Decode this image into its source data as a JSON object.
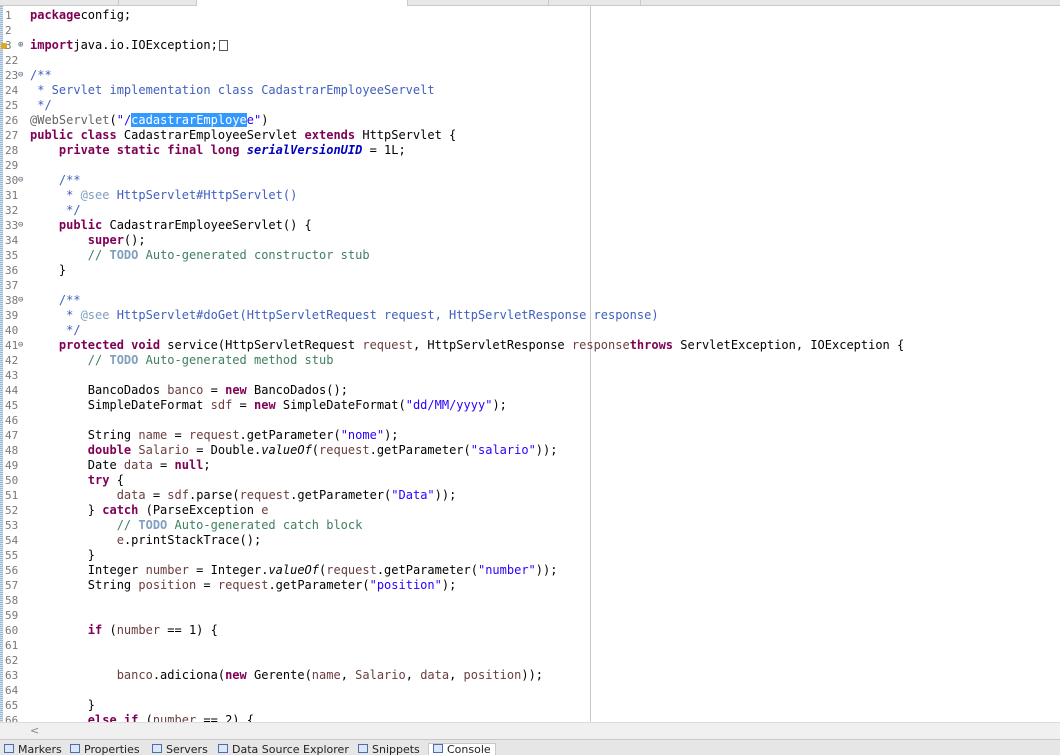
{
  "editor": {
    "lines": [
      {
        "n": "1",
        "fold": "",
        "warn": false,
        "tokens": [
          [
            "kw",
            "package"
          ],
          [
            "",
            "config;"
          ]
        ]
      },
      {
        "n": "2",
        "fold": "",
        "warn": false,
        "tokens": []
      },
      {
        "n": "3",
        "fold": "⊕",
        "warn": true,
        "tokens": [
          [
            "kw",
            "import"
          ],
          [
            "",
            "java.io.IOException;"
          ],
          [
            "box",
            ""
          ]
        ]
      },
      {
        "n": "22",
        "fold": "",
        "warn": false,
        "tokens": []
      },
      {
        "n": "23",
        "fold": "⊖",
        "warn": false,
        "tokens": [
          [
            "jd",
            "/**"
          ]
        ]
      },
      {
        "n": "24",
        "fold": "",
        "warn": false,
        "tokens": [
          [
            "jd",
            " * Servlet implementation class CadastrarEmployeeServelt"
          ]
        ]
      },
      {
        "n": "25",
        "fold": "",
        "warn": false,
        "tokens": [
          [
            "jd",
            " */"
          ]
        ]
      },
      {
        "n": "26",
        "fold": "",
        "warn": false,
        "tokens": [
          [
            "ann",
            "@WebServlet"
          ],
          [
            "",
            "("
          ],
          [
            "str",
            "\"/"
          ],
          [
            "sel",
            "cadastrarEmploye"
          ],
          [
            "str",
            "e\""
          ],
          [
            "",
            ")"
          ]
        ]
      },
      {
        "n": "27",
        "fold": "",
        "warn": false,
        "tokens": [
          [
            "kw",
            "public class"
          ],
          [
            "",
            " CadastrarEmployeeServlet "
          ],
          [
            "kw",
            "extends"
          ],
          [
            "",
            " HttpServlet {"
          ]
        ]
      },
      {
        "n": "28",
        "fold": "",
        "warn": false,
        "tokens": [
          [
            "",
            "    "
          ],
          [
            "kw",
            "private static final long"
          ],
          [
            "",
            " "
          ],
          [
            "sfld",
            "serialVersionUID"
          ],
          [
            "",
            " = 1L;"
          ]
        ]
      },
      {
        "n": "29",
        "fold": "",
        "warn": false,
        "tokens": []
      },
      {
        "n": "30",
        "fold": "⊖",
        "warn": false,
        "tokens": [
          [
            "jd",
            "    /**"
          ]
        ]
      },
      {
        "n": "31",
        "fold": "",
        "warn": false,
        "tokens": [
          [
            "jd",
            "     * "
          ],
          [
            "tag",
            "@see"
          ],
          [
            "jd",
            " HttpServlet#HttpServlet()"
          ]
        ]
      },
      {
        "n": "32",
        "fold": "",
        "warn": false,
        "tokens": [
          [
            "jd",
            "     */"
          ]
        ]
      },
      {
        "n": "33",
        "fold": "⊖",
        "warn": false,
        "tokens": [
          [
            "",
            "    "
          ],
          [
            "kw",
            "public"
          ],
          [
            "",
            " CadastrarEmployeeServlet() {"
          ]
        ]
      },
      {
        "n": "34",
        "fold": "",
        "warn": false,
        "tokens": [
          [
            "",
            "        "
          ],
          [
            "kw",
            "super"
          ],
          [
            "",
            "();"
          ]
        ]
      },
      {
        "n": "35",
        "fold": "",
        "warn": false,
        "tokens": [
          [
            "cm",
            "        // "
          ],
          [
            "todo",
            "TODO"
          ],
          [
            "cm",
            " Auto-generated constructor stub"
          ]
        ]
      },
      {
        "n": "36",
        "fold": "",
        "warn": false,
        "tokens": [
          [
            "",
            "    }"
          ]
        ]
      },
      {
        "n": "37",
        "fold": "",
        "warn": false,
        "tokens": []
      },
      {
        "n": "38",
        "fold": "⊖",
        "warn": false,
        "tokens": [
          [
            "jd",
            "    /**"
          ]
        ]
      },
      {
        "n": "39",
        "fold": "",
        "warn": false,
        "tokens": [
          [
            "jd",
            "     * "
          ],
          [
            "tag",
            "@see"
          ],
          [
            "jd",
            " HttpServlet#doGet(HttpServletRequest request, HttpServletResponse response)"
          ]
        ]
      },
      {
        "n": "40",
        "fold": "",
        "warn": false,
        "tokens": [
          [
            "jd",
            "     */"
          ]
        ]
      },
      {
        "n": "41",
        "fold": "⊖",
        "warn": false,
        "tokens": [
          [
            "",
            "    "
          ],
          [
            "kw",
            "protected void"
          ],
          [
            "",
            " service(HttpServletRequest "
          ],
          [
            "var",
            "request"
          ],
          [
            "",
            ", HttpServletResponse "
          ],
          [
            "var",
            "response"
          ],
          [
            ") "
          ],
          [
            "kw",
            "throws"
          ],
          [
            "",
            " ServletException, IOException {"
          ]
        ]
      },
      {
        "n": "42",
        "fold": "",
        "warn": false,
        "tokens": [
          [
            "cm",
            "        // "
          ],
          [
            "todo",
            "TODO"
          ],
          [
            "cm",
            " Auto-generated method stub"
          ]
        ]
      },
      {
        "n": "43",
        "fold": "",
        "warn": false,
        "tokens": []
      },
      {
        "n": "44",
        "fold": "",
        "warn": false,
        "tokens": [
          [
            "",
            "        BancoDados "
          ],
          [
            "var",
            "banco"
          ],
          [
            "",
            " = "
          ],
          [
            "kw",
            "new"
          ],
          [
            "",
            " BancoDados();"
          ]
        ]
      },
      {
        "n": "45",
        "fold": "",
        "warn": false,
        "tokens": [
          [
            "",
            "        SimpleDateFormat "
          ],
          [
            "var",
            "sdf"
          ],
          [
            "",
            " = "
          ],
          [
            "kw",
            "new"
          ],
          [
            "",
            " SimpleDateFormat("
          ],
          [
            "str",
            "\"dd/MM/yyyy\""
          ],
          [
            "",
            ");"
          ]
        ]
      },
      {
        "n": "46",
        "fold": "",
        "warn": false,
        "tokens": []
      },
      {
        "n": "47",
        "fold": "",
        "warn": false,
        "tokens": [
          [
            "",
            "        String "
          ],
          [
            "var",
            "name"
          ],
          [
            "",
            " = "
          ],
          [
            "var",
            "request"
          ],
          [
            "",
            ".getParameter("
          ],
          [
            "str",
            "\"nome\""
          ],
          [
            "",
            ");"
          ]
        ]
      },
      {
        "n": "48",
        "fold": "",
        "warn": false,
        "tokens": [
          [
            "",
            "        "
          ],
          [
            "kw",
            "double"
          ],
          [
            "",
            " "
          ],
          [
            "var",
            "Salario"
          ],
          [
            "",
            " = Double."
          ],
          [
            "ital",
            "valueOf"
          ],
          [
            "",
            "("
          ],
          [
            "var",
            "request"
          ],
          [
            "",
            ".getParameter("
          ],
          [
            "str",
            "\"salario\""
          ],
          [
            "",
            "));"
          ]
        ]
      },
      {
        "n": "49",
        "fold": "",
        "warn": false,
        "tokens": [
          [
            "",
            "        Date "
          ],
          [
            "var",
            "data"
          ],
          [
            "",
            " = "
          ],
          [
            "kw",
            "null"
          ],
          [
            "",
            ";"
          ]
        ]
      },
      {
        "n": "50",
        "fold": "",
        "warn": false,
        "tokens": [
          [
            "",
            "        "
          ],
          [
            "kw",
            "try"
          ],
          [
            "",
            " {"
          ]
        ]
      },
      {
        "n": "51",
        "fold": "",
        "warn": false,
        "tokens": [
          [
            "",
            "            "
          ],
          [
            "var",
            "data"
          ],
          [
            "",
            " = "
          ],
          [
            "var",
            "sdf"
          ],
          [
            "",
            ".parse("
          ],
          [
            "var",
            "request"
          ],
          [
            "",
            ".getParameter("
          ],
          [
            "str",
            "\"Data\""
          ],
          [
            "",
            "));"
          ]
        ]
      },
      {
        "n": "52",
        "fold": "",
        "warn": false,
        "tokens": [
          [
            "",
            "        } "
          ],
          [
            "kw",
            "catch"
          ],
          [
            "",
            " (ParseException "
          ],
          [
            "var",
            "e"
          ],
          [
            ") {"
          ]
        ]
      },
      {
        "n": "53",
        "fold": "",
        "warn": false,
        "tokens": [
          [
            "cm",
            "            // "
          ],
          [
            "todo",
            "TODO"
          ],
          [
            "cm",
            " Auto-generated catch block"
          ]
        ]
      },
      {
        "n": "54",
        "fold": "",
        "warn": false,
        "tokens": [
          [
            "",
            "            "
          ],
          [
            "var",
            "e"
          ],
          [
            "",
            ".printStackTrace();"
          ]
        ]
      },
      {
        "n": "55",
        "fold": "",
        "warn": false,
        "tokens": [
          [
            "",
            "        }"
          ]
        ]
      },
      {
        "n": "56",
        "fold": "",
        "warn": false,
        "tokens": [
          [
            "",
            "        Integer "
          ],
          [
            "var",
            "number"
          ],
          [
            "",
            " = Integer."
          ],
          [
            "ital",
            "valueOf"
          ],
          [
            "",
            "("
          ],
          [
            "var",
            "request"
          ],
          [
            "",
            ".getParameter("
          ],
          [
            "str",
            "\"number\""
          ],
          [
            "",
            "));"
          ]
        ]
      },
      {
        "n": "57",
        "fold": "",
        "warn": false,
        "tokens": [
          [
            "",
            "        String "
          ],
          [
            "var",
            "position"
          ],
          [
            "",
            " = "
          ],
          [
            "var",
            "request"
          ],
          [
            "",
            ".getParameter("
          ],
          [
            "str",
            "\"position\""
          ],
          [
            "",
            ");"
          ]
        ]
      },
      {
        "n": "58",
        "fold": "",
        "warn": false,
        "tokens": []
      },
      {
        "n": "59",
        "fold": "",
        "warn": false,
        "tokens": []
      },
      {
        "n": "60",
        "fold": "",
        "warn": false,
        "tokens": [
          [
            "",
            "        "
          ],
          [
            "kw",
            "if"
          ],
          [
            "",
            " ("
          ],
          [
            "var",
            "number"
          ],
          [
            "",
            " == 1) {"
          ]
        ]
      },
      {
        "n": "61",
        "fold": "",
        "warn": false,
        "tokens": []
      },
      {
        "n": "62",
        "fold": "",
        "warn": false,
        "tokens": []
      },
      {
        "n": "63",
        "fold": "",
        "warn": false,
        "tokens": [
          [
            "",
            "            "
          ],
          [
            "var",
            "banco"
          ],
          [
            "",
            ".adiciona("
          ],
          [
            "kw",
            "new"
          ],
          [
            "",
            " Gerente("
          ],
          [
            "var",
            "name"
          ],
          [
            "",
            ", "
          ],
          [
            "var",
            "Salario"
          ],
          [
            "",
            ", "
          ],
          [
            "var",
            "data"
          ],
          [
            "",
            ", "
          ],
          [
            "var",
            "position"
          ],
          [
            "",
            "));"
          ]
        ]
      },
      {
        "n": "64",
        "fold": "",
        "warn": false,
        "tokens": []
      },
      {
        "n": "65",
        "fold": "",
        "warn": false,
        "tokens": [
          [
            "",
            "        }"
          ]
        ]
      },
      {
        "n": "66",
        "fold": "",
        "warn": false,
        "tokens": [
          [
            "",
            "        "
          ],
          [
            "kw",
            "else if"
          ],
          [
            "",
            " ("
          ],
          [
            "var",
            "number"
          ],
          [
            "",
            " == 2) {"
          ]
        ]
      }
    ]
  },
  "scrollbar": {
    "left_arrow": "<"
  },
  "bottom_tabs": [
    {
      "label": "Markers",
      "active": false
    },
    {
      "label": "Properties",
      "active": false
    },
    {
      "label": "Servers",
      "active": false
    },
    {
      "label": "Data Source Explorer",
      "active": false
    },
    {
      "label": "Snippets",
      "active": false
    },
    {
      "label": "Console",
      "active": true
    }
  ]
}
